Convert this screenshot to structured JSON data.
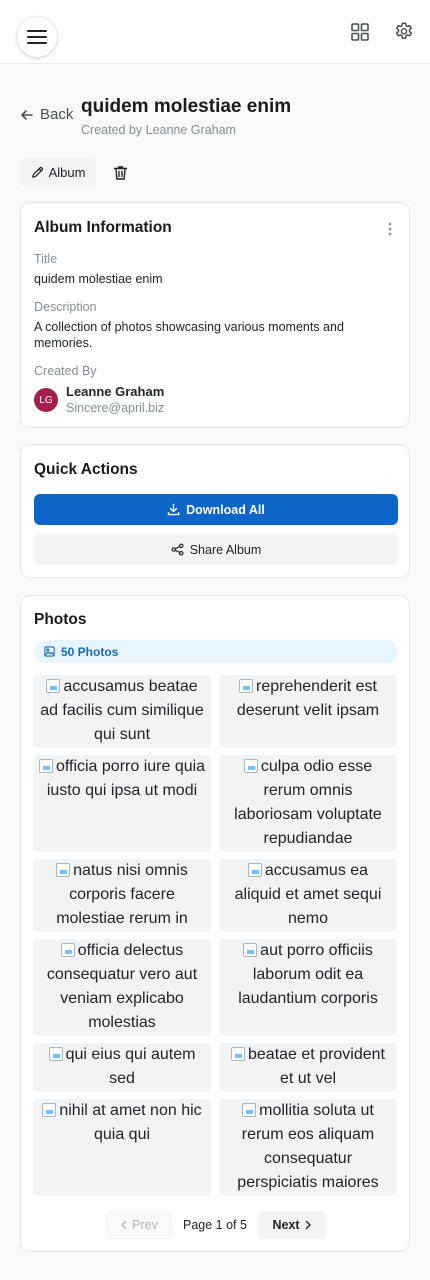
{
  "header": {
    "back_label": "Back",
    "title": "quidem molestiae enim",
    "subtitle": "Created by Leanne Graham"
  },
  "toolbar": {
    "edit_label": "Album"
  },
  "info_card": {
    "heading": "Album Information",
    "title_label": "Title",
    "title_value": "quidem molestiae enim",
    "description_label": "Description",
    "description_value": "A collection of photos showcasing various moments and memories.",
    "created_by_label": "Created By",
    "creator": {
      "initials": "LG",
      "name": "Leanne Graham",
      "email": "Sincere@april.biz",
      "avatar_color": "#a61e4d"
    }
  },
  "quick_actions": {
    "heading": "Quick Actions",
    "download_label": "Download All",
    "share_label": "Share Album",
    "primary_color": "#0b66c8"
  },
  "photos": {
    "heading": "Photos",
    "count_label": "50 Photos",
    "items": [
      {
        "alt": "accusamus beatae ad facilis cum similique qui sunt"
      },
      {
        "alt": "reprehenderit est deserunt velit ipsam"
      },
      {
        "alt": "officia porro iure quia iusto qui ipsa ut modi"
      },
      {
        "alt": "culpa odio esse rerum omnis laboriosam voluptate repudiandae"
      },
      {
        "alt": "natus nisi omnis corporis facere molestiae rerum in"
      },
      {
        "alt": "accusamus ea aliquid et amet sequi nemo"
      },
      {
        "alt": "officia delectus consequatur vero aut veniam explicabo molestias"
      },
      {
        "alt": "aut porro officiis laborum odit ea laudantium corporis"
      },
      {
        "alt": "qui eius qui autem sed"
      },
      {
        "alt": "beatae et provident et ut vel"
      },
      {
        "alt": "nihil at amet non hic quia qui"
      },
      {
        "alt": "mollitia soluta ut rerum eos aliquam consequatur perspiciatis maiores"
      }
    ]
  },
  "pagination": {
    "prev_label": "Prev",
    "page_info": "Page 1 of 5",
    "next_label": "Next"
  }
}
